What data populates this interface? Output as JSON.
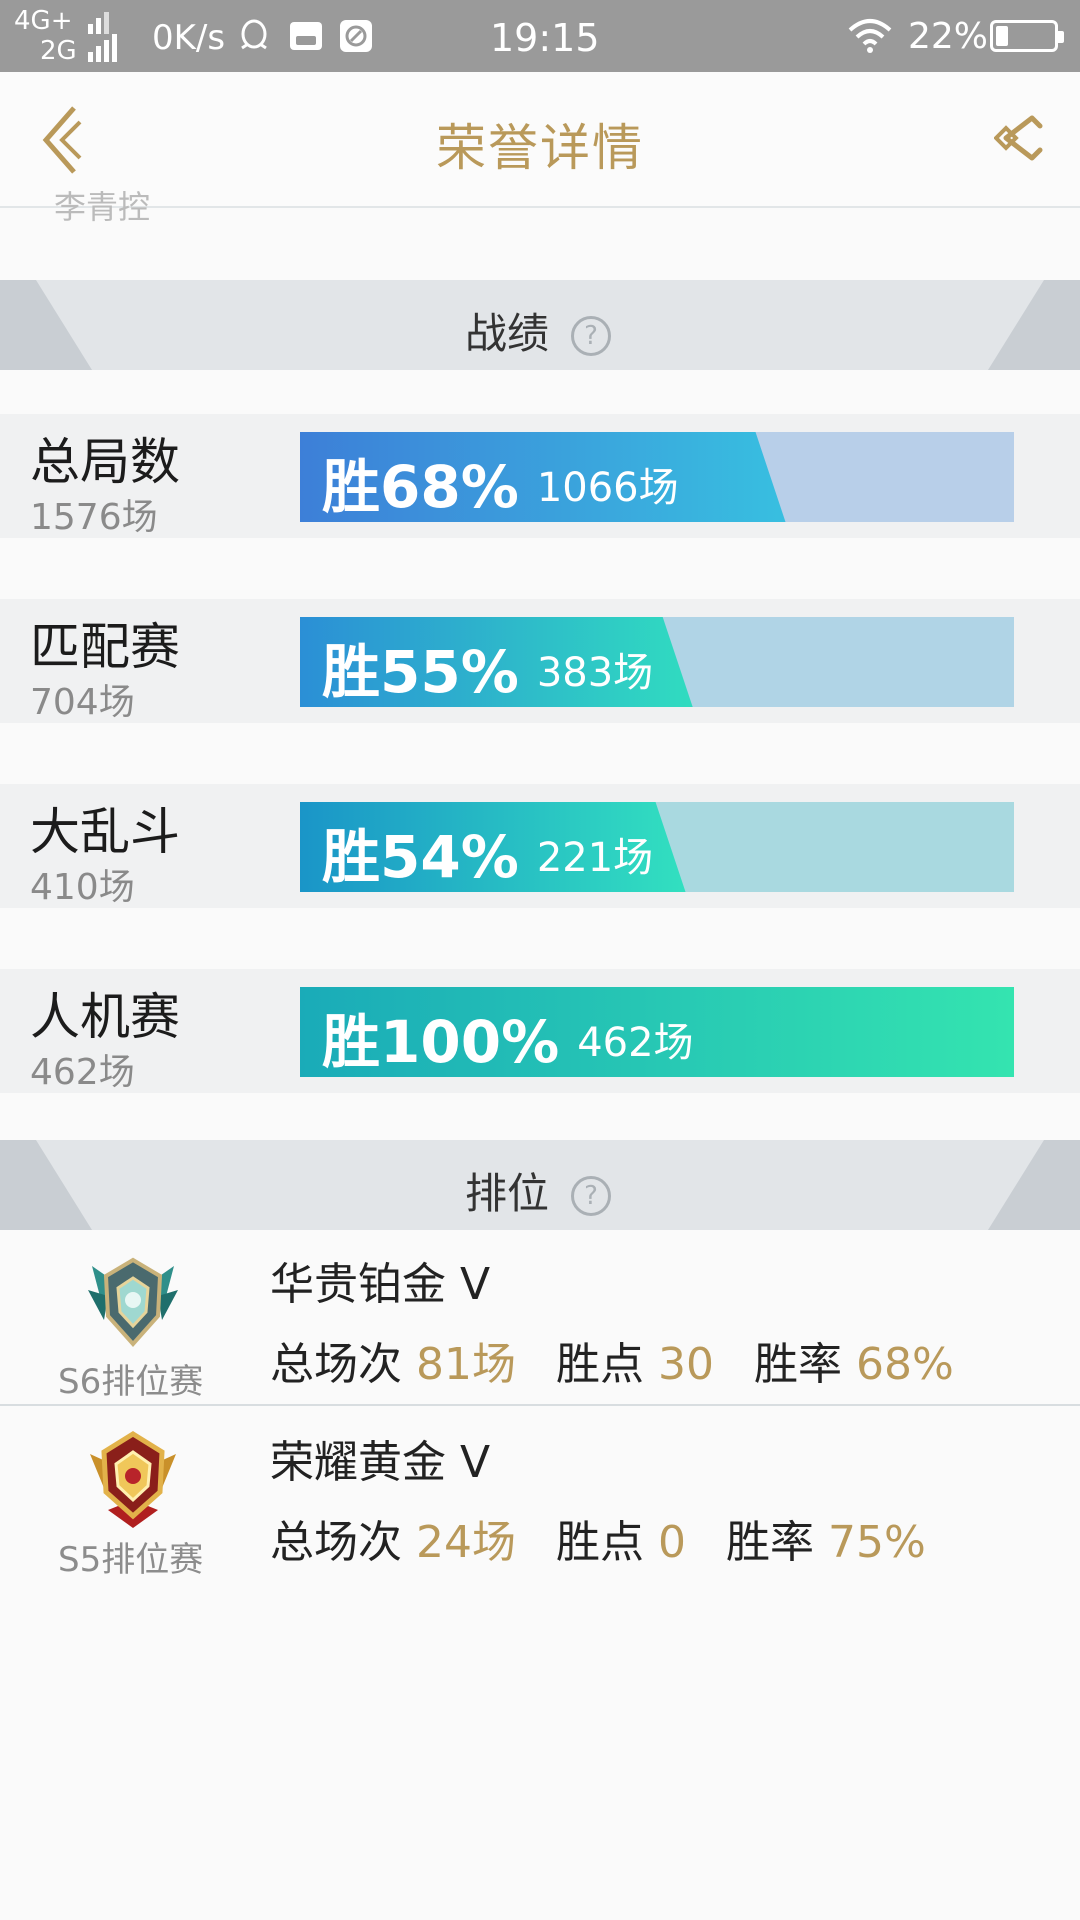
{
  "status_bar": {
    "net_top": "4G+",
    "net_bottom": "2G",
    "speed": "0K/s",
    "time": "19:15",
    "battery_percent_text": "22%",
    "battery_level": 0.22,
    "icons": [
      "signal-icon",
      "qq-icon",
      "vivo-icon",
      "app-icon",
      "wifi-icon",
      "battery-icon"
    ]
  },
  "header": {
    "title": "荣誉详情",
    "back_icon": "chevron-left-icon",
    "share_icon": "share-icon"
  },
  "partial_text": "李青控",
  "record_section": {
    "title": "战绩",
    "help_icon": "?",
    "rows": [
      {
        "name": "总局数",
        "total": "1576场",
        "rate_text": "胜68%",
        "wins_text": "1066场",
        "rate": 0.68,
        "fill_start": "#3d7fd8",
        "fill_end": "#38bfe0",
        "track": "#b8cfe9"
      },
      {
        "name": "匹配赛",
        "total": "704场",
        "rate_text": "胜55%",
        "wins_text": "383场",
        "rate": 0.55,
        "fill_start": "#2b8fd6",
        "fill_end": "#30dcc0",
        "track": "#b0d4e6"
      },
      {
        "name": "大乱斗",
        "total": "410场",
        "rate_text": "胜54%",
        "wins_text": "221场",
        "rate": 0.54,
        "fill_start": "#1a95c8",
        "fill_end": "#32e0c0",
        "track": "#a9d9e0"
      },
      {
        "name": "人机赛",
        "total": "462场",
        "rate_text": "胜100%",
        "wins_text": "462场",
        "rate": 1.0,
        "fill_start": "#1aabb8",
        "fill_end": "#34e4b0",
        "track": "#a8e0d6"
      }
    ]
  },
  "rank_section": {
    "title": "排位",
    "help_icon": "?",
    "rows": [
      {
        "season": "S6排位赛",
        "tier": "华贵铂金 V",
        "games_label": "总场次",
        "games": "81场",
        "points_label": "胜点",
        "points": "30",
        "rate_label": "胜率",
        "rate": "68%",
        "badge_icon": "platinum-badge-icon"
      },
      {
        "season": "S5排位赛",
        "tier": "荣耀黄金 V",
        "games_label": "总场次",
        "games": "24场",
        "points_label": "胜点",
        "points": "0",
        "rate_label": "胜率",
        "rate": "75%",
        "badge_icon": "gold-badge-icon"
      }
    ]
  }
}
